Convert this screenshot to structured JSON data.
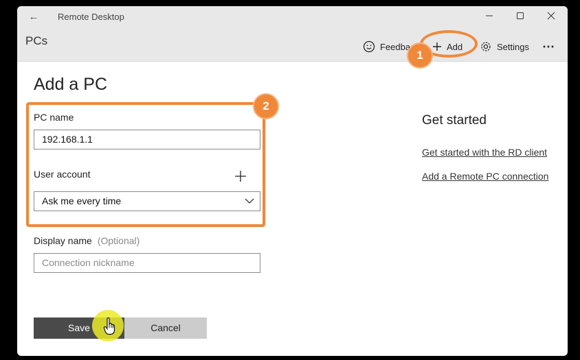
{
  "window": {
    "back_icon": "arrow-left-icon",
    "app_title": "Remote Desktop",
    "minimize_icon": "minimize-icon",
    "maximize_icon": "maximize-icon",
    "close_icon": "close-icon"
  },
  "header": {
    "section_title": "PCs",
    "feedback_label": "Feedback",
    "add_label": "Add",
    "settings_label": "Settings",
    "more_icon": "more-icon"
  },
  "form": {
    "heading": "Add a PC",
    "pc_name_label": "PC name",
    "pc_name_value": "192.168.1.1",
    "user_account_label": "User account",
    "user_account_value": "Ask me every time",
    "display_name_label": "Display name",
    "display_name_optional": "(Optional)",
    "display_name_placeholder": "Connection nickname",
    "save_label": "Save",
    "cancel_label": "Cancel"
  },
  "sidebar": {
    "title": "Get started",
    "links": [
      "Get started with the RD client",
      "Add a Remote PC connection"
    ]
  },
  "annotations": {
    "step1": "1",
    "step2": "2",
    "accent_color": "#f0883a"
  }
}
